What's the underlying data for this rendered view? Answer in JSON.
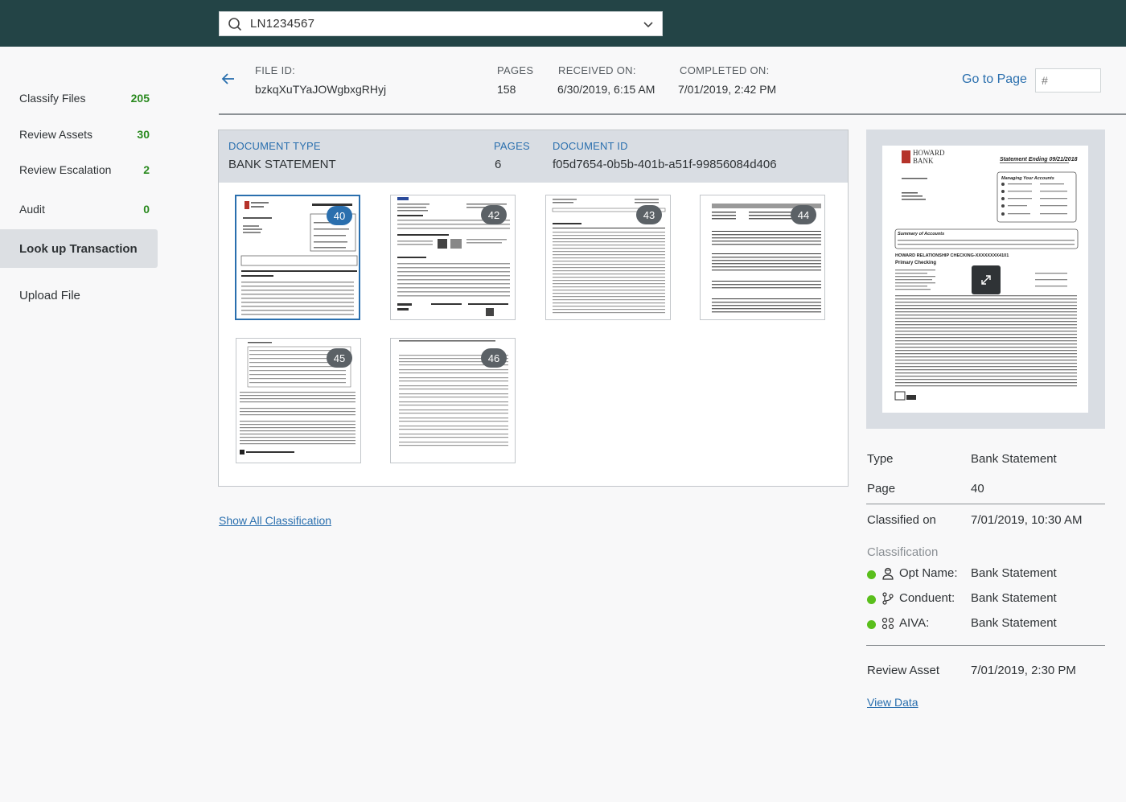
{
  "search": {
    "value": "LN1234567",
    "icon": "search-icon"
  },
  "sidebar": {
    "items": [
      {
        "label": "Classify Files",
        "count": "205"
      },
      {
        "label": "Review Assets",
        "count": "30"
      },
      {
        "label": "Review Escalation",
        "count": "2"
      },
      {
        "label": "Audit",
        "count": "0"
      },
      {
        "label": "Look up Transaction",
        "active": true
      },
      {
        "label": "Upload File"
      }
    ]
  },
  "file": {
    "id_label": "FILE ID:",
    "id": "bzkqXuTYaJOWgbxgRHyj",
    "pages_label": "PAGES",
    "pages": "158",
    "received_label": "RECEIVED ON:",
    "received": "6/30/2019, 6:15 AM",
    "completed_label": "COMPLETED ON:",
    "completed": "7/01/2019, 2:42 PM"
  },
  "goto": {
    "label": "Go to Page",
    "placeholder": "#"
  },
  "document": {
    "type_label": "DOCUMENT TYPE",
    "type": "BANK STATEMENT",
    "pages_label": "PAGES",
    "pages": "6",
    "id_label": "DOCUMENT ID",
    "id": "f05d7654-0b5b-401b-a51f-99856084d406"
  },
  "thumbnails": [
    {
      "page": "40",
      "selected": true
    },
    {
      "page": "42"
    },
    {
      "page": "43"
    },
    {
      "page": "44"
    },
    {
      "page": "45"
    },
    {
      "page": "46"
    }
  ],
  "show_all_label": "Show All Classification",
  "preview": {
    "bank_name_1": "HOWARD",
    "bank_name_2": "BANK",
    "statement_ending": "Statement Ending 09/21/2018",
    "managing_title": "Managing Your Accounts",
    "summary_title": "Summary of Accounts",
    "checking_title": "HOWARD RELATIONSHIP CHECKING-XXXXXXXX4101",
    "primary_checking": "Primary Checking"
  },
  "info": {
    "type_label": "Type",
    "type": "Bank Statement",
    "page_label": "Page",
    "page": "40",
    "classified_label": "Classified on",
    "classified": "7/01/2019, 10:30 AM",
    "classification_title": "Classification",
    "classifiers": [
      {
        "label": "Opt Name:",
        "value": "Bank Statement",
        "icon": "person-icon"
      },
      {
        "label": "Conduent:",
        "value": "Bank Statement",
        "icon": "branch-icon"
      },
      {
        "label": "AIVA:",
        "value": "Bank Statement",
        "icon": "network-icon"
      }
    ],
    "review_label": "Review Asset",
    "review": "7/01/2019, 2:30 PM",
    "view_data_label": "View Data"
  },
  "colors": {
    "topbar": "#234446",
    "accent": "#2a6fae",
    "count": "#2a8a1f",
    "status": "#5abf1c"
  }
}
